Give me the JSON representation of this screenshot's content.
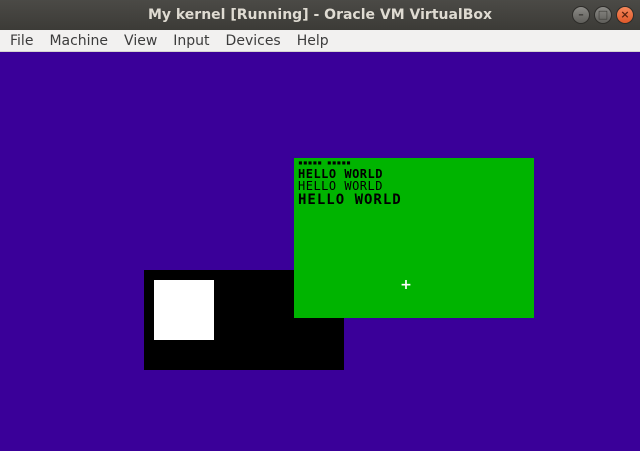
{
  "window": {
    "title": "My kernel [Running] - Oracle VM VirtualBox",
    "controls": {
      "minimize": "–",
      "maximize": "□",
      "close": "×"
    }
  },
  "menu": {
    "items": [
      "File",
      "Machine",
      "View",
      "Input",
      "Devices",
      "Help"
    ]
  },
  "guest": {
    "background": "#3a0099",
    "green_window": {
      "color": "#00b400",
      "dots": "▪▪▪▪▪ ▪▪▪▪▪",
      "lines": [
        "HELLO WORLD",
        "HELLO WORLD",
        "HELLO WORLD"
      ],
      "cursor": "+"
    },
    "black_rect_color": "#000000",
    "white_square_color": "#ffffff"
  }
}
